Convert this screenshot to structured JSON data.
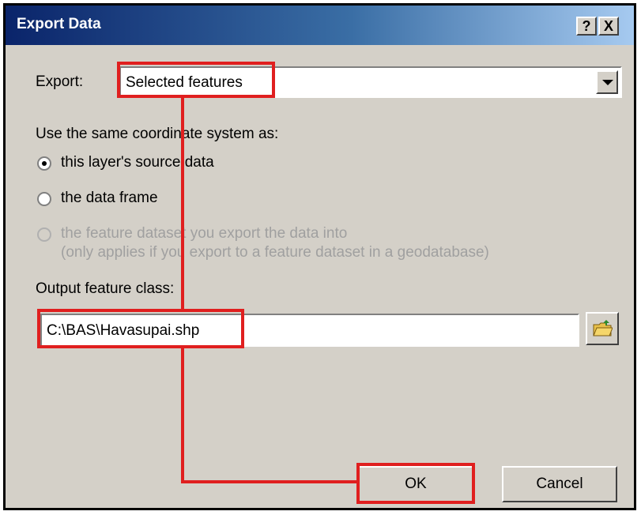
{
  "window": {
    "title": "Export Data",
    "help_label": "?",
    "close_label": "X"
  },
  "export": {
    "label": "Export:",
    "selected": "Selected features"
  },
  "coordinate_system": {
    "label": "Use the same coordinate system as:",
    "options": [
      {
        "label": "this layer's source data",
        "checked": true,
        "enabled": true
      },
      {
        "label": "the data frame",
        "checked": false,
        "enabled": true
      },
      {
        "label": "the feature dataset you export the data into",
        "checked": false,
        "enabled": false
      }
    ],
    "note": "(only applies if you export to a feature dataset in a geodatabase)"
  },
  "output": {
    "label": "Output feature class:",
    "value": "C:\\BAS\\Havasupai.shp",
    "browse_icon": "folder-open-icon"
  },
  "buttons": {
    "ok": "OK",
    "cancel": "Cancel"
  },
  "annotation": {
    "highlight_color": "#e01f1f"
  }
}
